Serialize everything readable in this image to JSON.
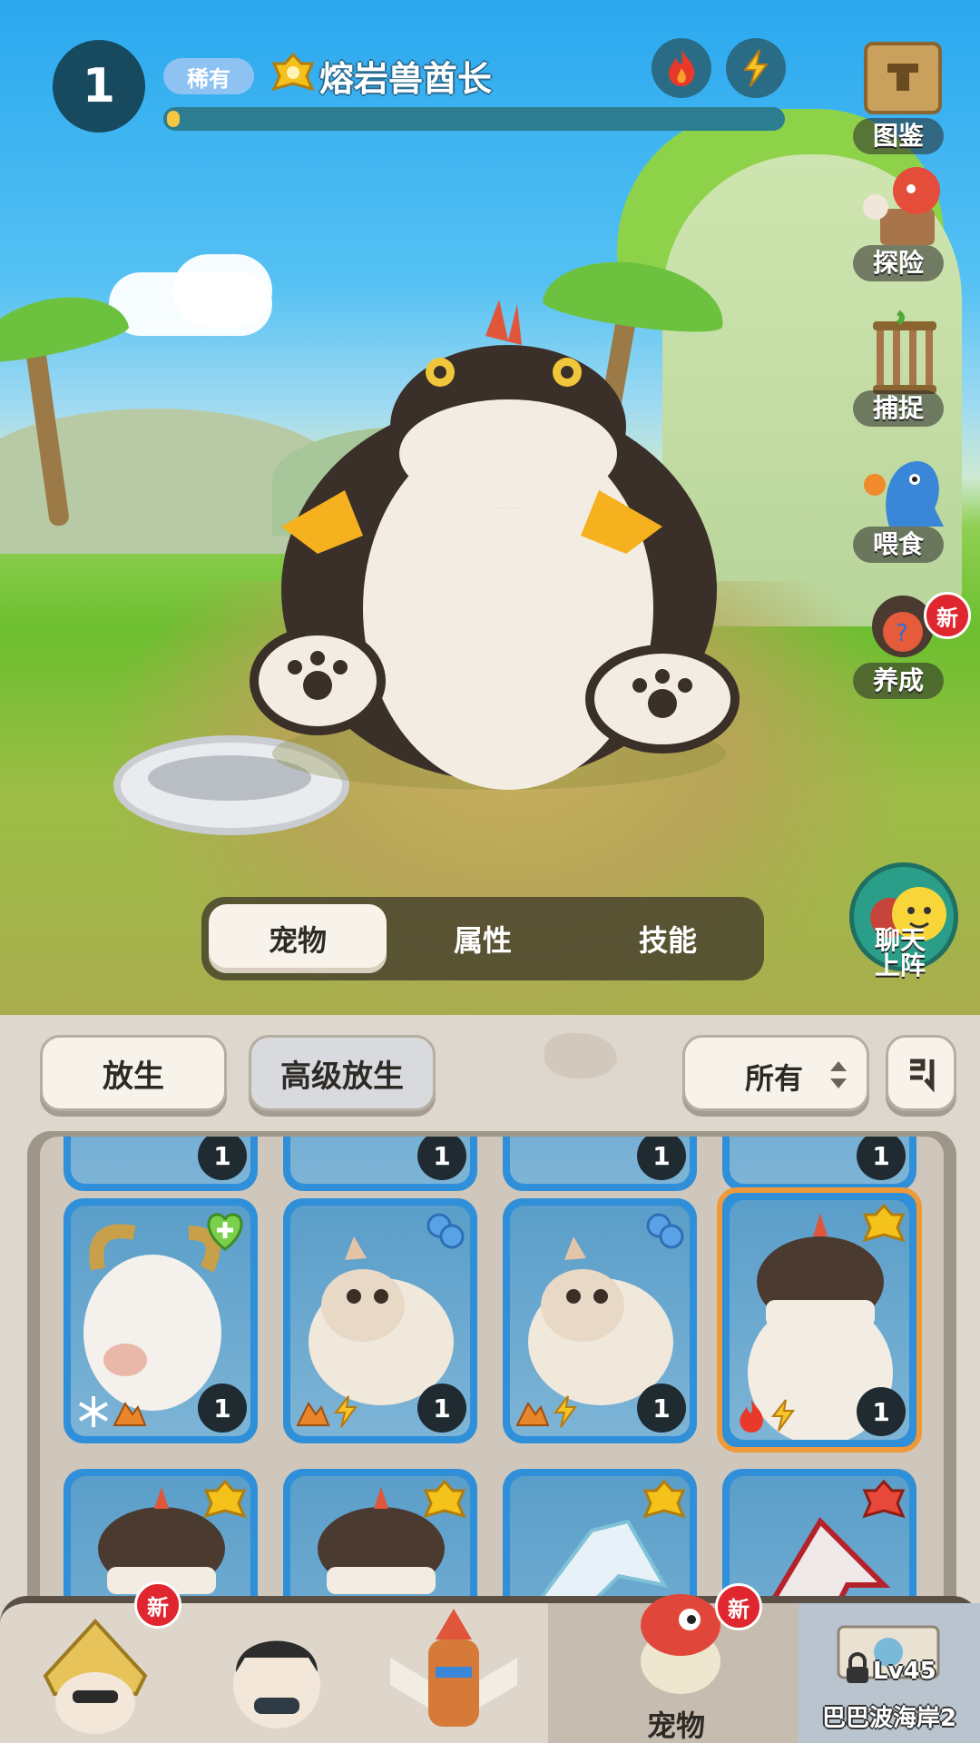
{
  "header": {
    "level": "1",
    "rarity": "稀有",
    "pet_name": "熔岩兽酋长",
    "xp_progress": 0.02,
    "elements": [
      "fire-icon",
      "lightning-icon"
    ]
  },
  "side_menu": [
    {
      "id": "codex",
      "label": "图鉴",
      "icon": "codex-book-icon"
    },
    {
      "id": "explore",
      "label": "探险",
      "icon": "explore-icon"
    },
    {
      "id": "capture",
      "label": "捕捉",
      "icon": "cage-icon"
    },
    {
      "id": "feed",
      "label": "喂食",
      "icon": "feed-icon"
    },
    {
      "id": "train",
      "label": "养成",
      "icon": "train-icon",
      "badge": "新"
    }
  ],
  "chat": {
    "line1": "聊天",
    "line2": "上阵"
  },
  "tabs": [
    {
      "label": "宠物",
      "active": true
    },
    {
      "label": "属性",
      "active": false
    },
    {
      "label": "技能",
      "active": false
    }
  ],
  "actions": {
    "release": "放生",
    "advanced_release": "高级放生",
    "filter_value": "所有"
  },
  "grid": {
    "top_row_levels": [
      "1",
      "1",
      "1",
      "1"
    ],
    "row1": [
      {
        "name": "white-yak-pet",
        "level": "1",
        "badge": "heal-icon",
        "elements": [
          "ice-icon",
          "earth-icon"
        ]
      },
      {
        "name": "squirrel-pet",
        "level": "1",
        "badge": "wind-icon",
        "elements": [
          "earth-icon",
          "lightning-icon"
        ]
      },
      {
        "name": "squirrel-pet",
        "level": "1",
        "badge": "wind-icon",
        "elements": [
          "earth-icon",
          "lightning-icon"
        ]
      },
      {
        "name": "lava-chief-pet",
        "level": "1",
        "badge": "gold-rank-icon",
        "elements": [
          "fire-icon",
          "lightning-icon"
        ],
        "selected": true
      }
    ],
    "row2": [
      {
        "name": "lava-chief-pet",
        "badge": "gold-rank-icon"
      },
      {
        "name": "lava-chief-pet",
        "badge": "gold-rank-icon"
      },
      {
        "name": "ice-dragon-pet",
        "badge": "gold-rank-icon"
      },
      {
        "name": "red-dragon-pet",
        "badge": "red-rank-icon"
      }
    ]
  },
  "bottom_nav": [
    {
      "id": "hero1",
      "badge": "新"
    },
    {
      "id": "hero2"
    },
    {
      "id": "hero3"
    },
    {
      "id": "pets",
      "label": "宠物",
      "badge": "新",
      "active": true
    },
    {
      "id": "locked",
      "level": "Lv45",
      "label": "巴巴波海岸2",
      "locked": true
    }
  ],
  "colors": {
    "level_circle": "#17495f",
    "rarity_badge": "#8dc2f2",
    "xp_fill": "#f7c542",
    "new_badge": "#e0262f",
    "card_blue": "#2f8fd9",
    "selected_border": "#f0993a"
  }
}
